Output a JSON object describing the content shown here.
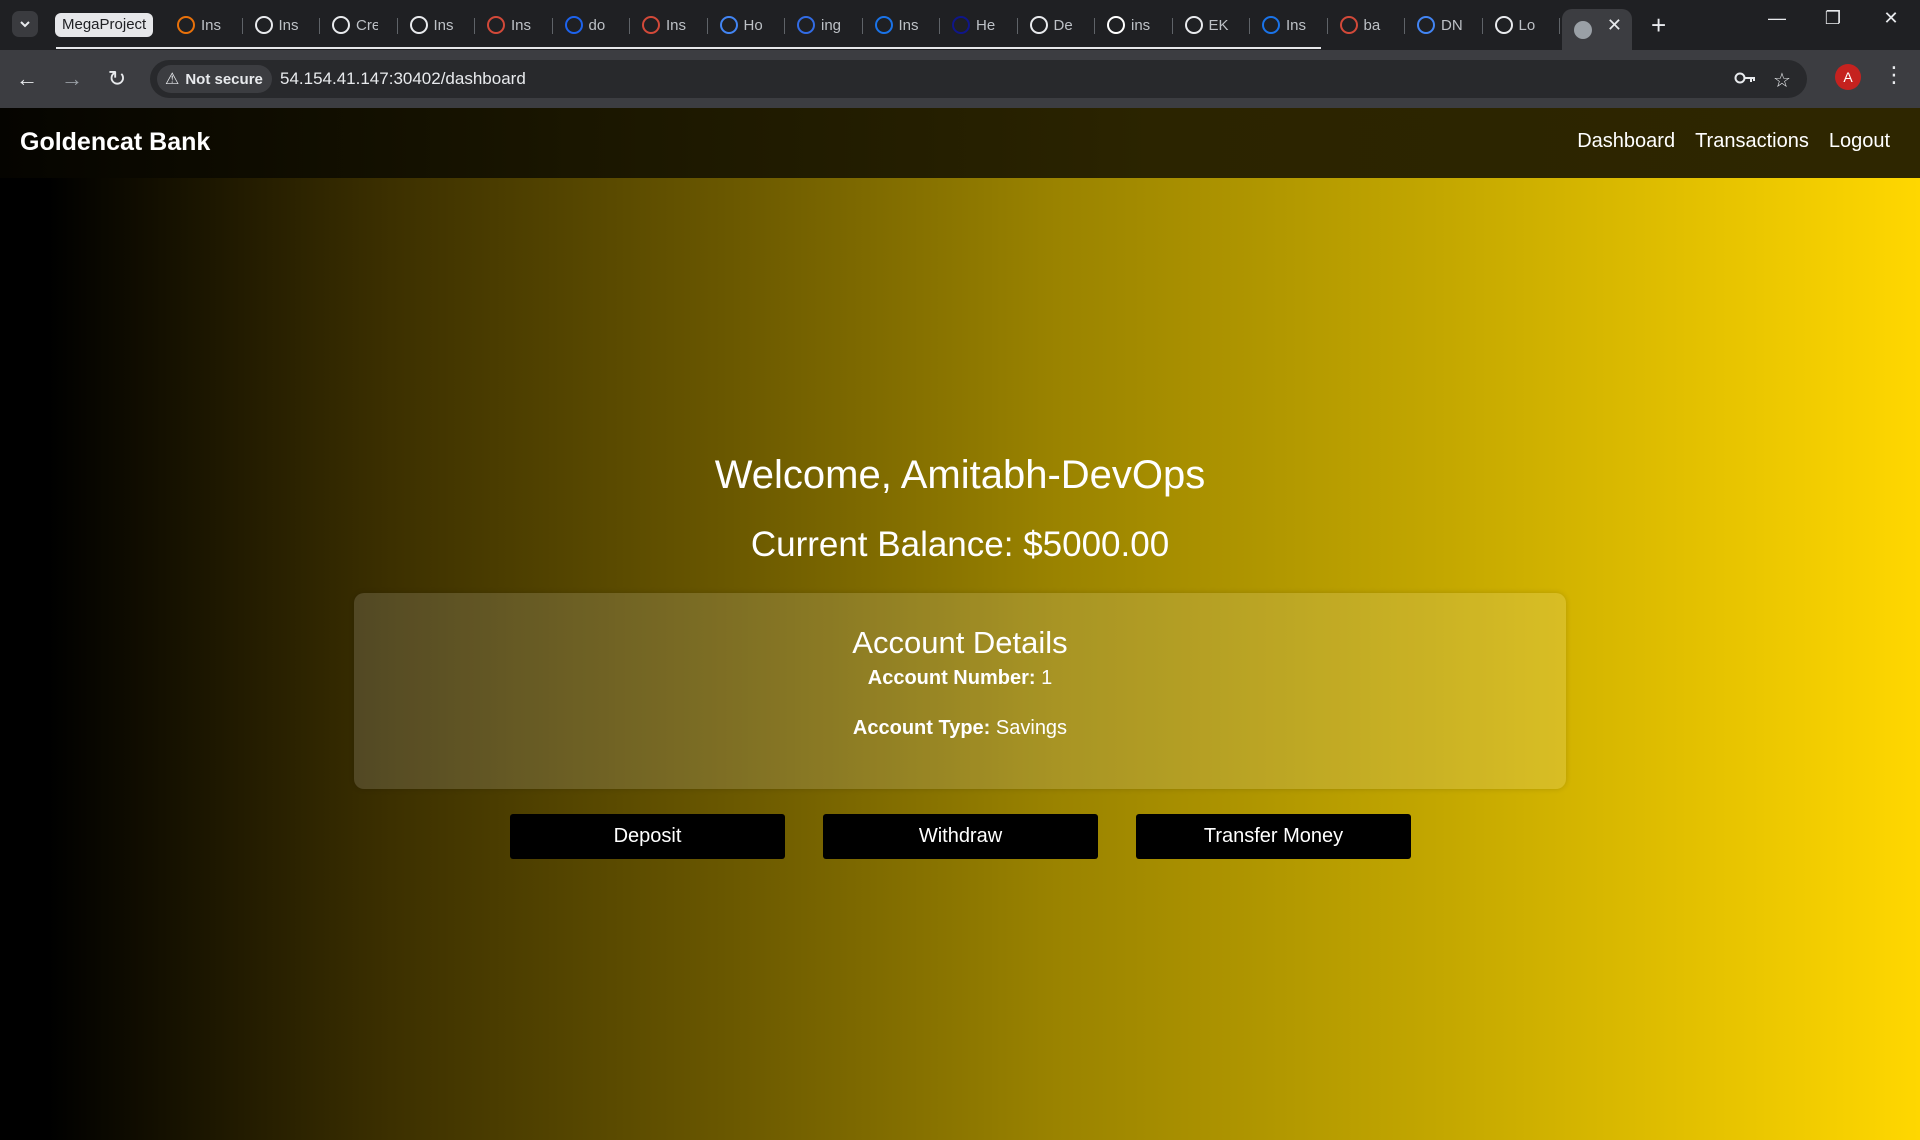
{
  "browser": {
    "tab_group_label": "MegaProject",
    "tabs": [
      {
        "title": "Ins",
        "icon": "instance-icon",
        "color": "#e8710a"
      },
      {
        "title": "Ins",
        "icon": "openai-icon",
        "color": "#e8eaed"
      },
      {
        "title": "Cre",
        "icon": "openai-icon",
        "color": "#e8eaed"
      },
      {
        "title": "Ins",
        "icon": "hashicorp-icon",
        "color": "#e8eaed"
      },
      {
        "title": "Ins",
        "icon": "jenkins-icon",
        "color": "#d24939"
      },
      {
        "title": "do",
        "icon": "docker-icon",
        "color": "#1d63ed"
      },
      {
        "title": "Ins",
        "icon": "jenkins-icon",
        "color": "#d24939"
      },
      {
        "title": "Ho",
        "icon": "argo-icon",
        "color": "#4285f4"
      },
      {
        "title": "ing",
        "icon": "kubernetes-icon",
        "color": "#326ce5"
      },
      {
        "title": "Ins",
        "icon": "download-icon",
        "color": "#1a73e8"
      },
      {
        "title": "He",
        "icon": "helm-icon",
        "color": "#0f1689"
      },
      {
        "title": "De",
        "icon": "github-icon",
        "color": "#e8eaed"
      },
      {
        "title": "ins",
        "icon": "google-icon",
        "color": "#ffffff"
      },
      {
        "title": "EK",
        "icon": "openai-icon",
        "color": "#e8eaed"
      },
      {
        "title": "Ins",
        "icon": "diamond-icon",
        "color": "#1a73e8"
      },
      {
        "title": "ba",
        "icon": "jenkins-icon",
        "color": "#d24939"
      },
      {
        "title": "DN",
        "icon": "spiral-icon",
        "color": "#4285f4"
      },
      {
        "title": "Lo",
        "icon": "globe-icon",
        "color": "#e8eaed"
      }
    ],
    "active_tab_icon": "globe-icon",
    "security_label": "Not secure",
    "url": "54.154.41.147:30402/dashboard",
    "profile_initial": "A"
  },
  "site": {
    "brand": "Goldencat Bank",
    "nav": [
      "Dashboard",
      "Transactions",
      "Logout"
    ]
  },
  "dashboard": {
    "welcome": "Welcome, Amitabh-DevOps",
    "balance": "Current Balance: $5000.00",
    "details_title": "Account Details",
    "account_number_label": "Account Number:",
    "account_number": "1",
    "account_type_label": "Account Type:",
    "account_type": "Savings",
    "buttons": [
      "Deposit",
      "Withdraw",
      "Transfer Money"
    ]
  },
  "colors": {
    "gradient_start": "#000000",
    "gradient_end": "#ffd700",
    "button_bg": "#000000"
  }
}
